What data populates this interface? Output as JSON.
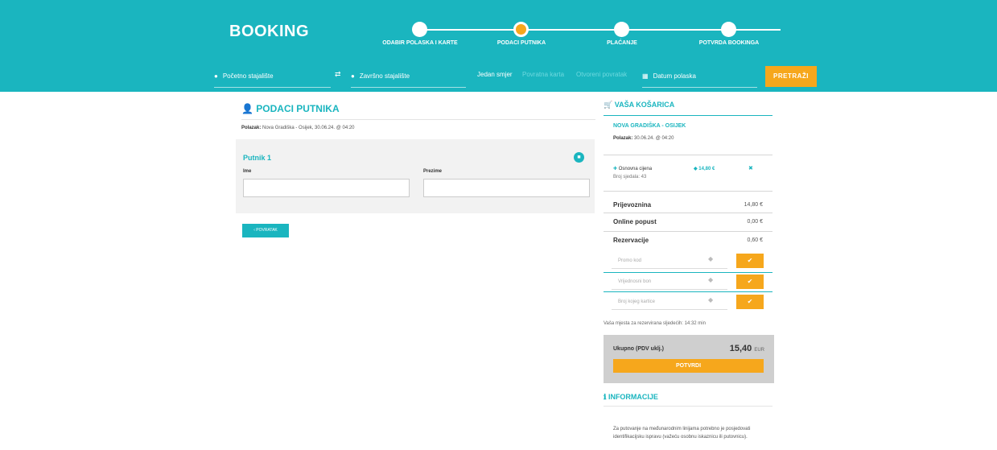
{
  "header": {
    "brand": "BOOKING",
    "steps": [
      "ODABIR POLASKA I KARTE",
      "PODACI PUTNIKA",
      "PLAĆANJE",
      "POTVRDA BOOKINGA"
    ]
  },
  "search": {
    "from": "Početno stajalište",
    "to": "Završno stajalište",
    "trip_one_way": "Jedan smjer",
    "trip_round": "Povratna karta",
    "trip_open": "Otvoreni povratak",
    "date": "Datum polaska",
    "button": "PRETRAŽI"
  },
  "passenger": {
    "title": "PODACI PUTNIKA",
    "polazak_label": "Polazak:",
    "polazak_value": "Nova Gradiška - Osijek, 30.06.24. @ 04:20",
    "passenger_title": "Putnik 1",
    "first_name_label": "Ime",
    "last_name_label": "Prezime",
    "back_button": "POVRATAK"
  },
  "cart": {
    "title": "VAŠA KOŠARICA",
    "route": "NOVA GRADIŠKA - OSIJEK",
    "polazak_label": "Polazak:",
    "polazak_value": "30.06.24. @ 04:20",
    "item_label": "Osnovna cijena",
    "item_seat": "Broj sjedala: 43",
    "item_price": "14,80 €",
    "fare_label": "Prijevoznina",
    "fare_value": "14,80 €",
    "online_label": "Online popust",
    "online_value": "0,00 €",
    "reservation_label": "Rezervacije",
    "reservation_value": "0,60 €",
    "promo_placeholder": "Promo kod",
    "voucher_placeholder": "Vrijednosni bon",
    "loyalty_placeholder": "Broj kojeg kartice",
    "timer": "Vaša mjesta za rezervirana sljedećih: 14:32 min",
    "total_label": "Ukupno (PDV uklj.)",
    "total_value": "15,40",
    "total_currency": "EUR",
    "confirm_button": "POTVRDI"
  },
  "info": {
    "title": "INFORMACIJE",
    "text": "Za putovanje na međunarodnim linijama potrebno je posjedovati identifikacijsku ispravu (važeću osobnu iskaznicu ili putovnicu)."
  },
  "colors": {
    "teal": "#1ab5bf",
    "orange": "#f6a71c"
  }
}
